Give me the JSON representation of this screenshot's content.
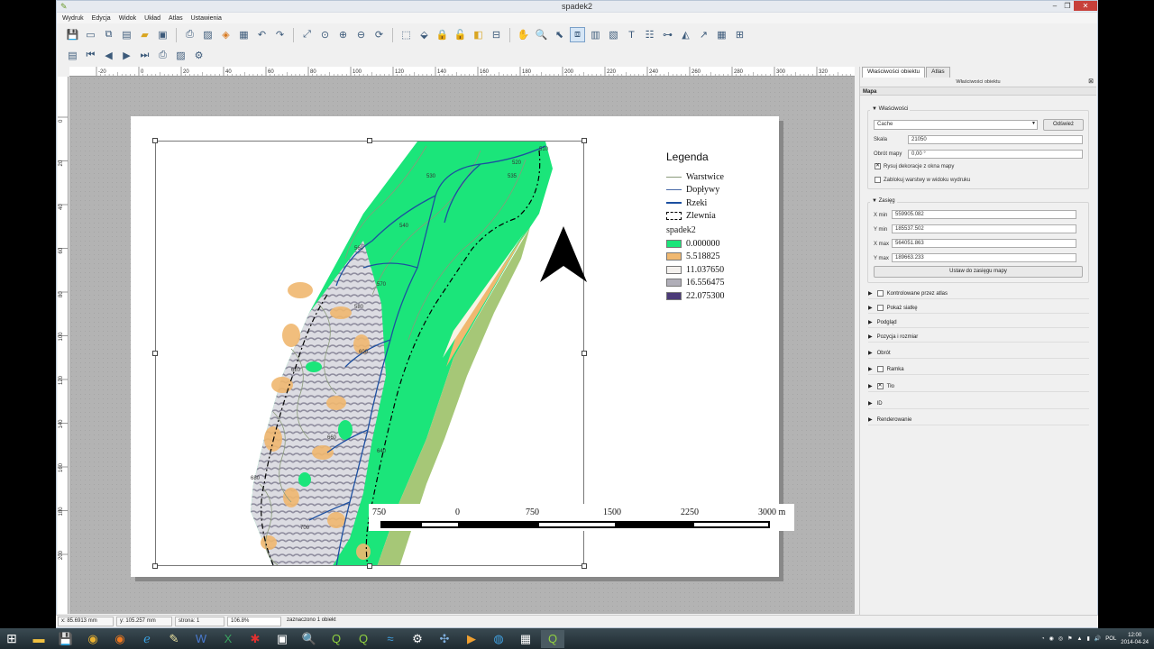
{
  "window": {
    "title": "spadek2"
  },
  "menu": [
    "Wydruk",
    "Edycja",
    "Widok",
    "Układ",
    "Atlas",
    "Ustawienia"
  ],
  "ruler": {
    "h_ticks": [
      "-20",
      "0",
      "20",
      "40",
      "60",
      "80",
      "100",
      "120",
      "140",
      "160",
      "180",
      "200",
      "220",
      "240",
      "260",
      "280",
      "300",
      "320"
    ],
    "v_ticks": [
      "0",
      "20",
      "40",
      "60",
      "80",
      "100",
      "120",
      "140",
      "160",
      "180",
      "200"
    ]
  },
  "legend": {
    "title": "Legenda",
    "items": [
      {
        "label": "Warstwice",
        "kind": "line",
        "color": "#8a9a7a"
      },
      {
        "label": "Dopływy",
        "kind": "line",
        "color": "#4a6aa8"
      },
      {
        "label": "Rzeki",
        "kind": "line",
        "color": "#1c4fa0"
      },
      {
        "label": "Zlewnia",
        "kind": "box",
        "color": "#000000"
      }
    ],
    "raster_name": "spadek2",
    "classes": [
      {
        "label": "0.000000",
        "color": "#1be57a"
      },
      {
        "label": "5.518825",
        "color": "#f0b870"
      },
      {
        "label": "11.037650",
        "color": "#f4f1ee"
      },
      {
        "label": "16.556475",
        "color": "#b0aeb8"
      },
      {
        "label": "22.075300",
        "color": "#4b3a78"
      }
    ]
  },
  "contours": [
    "510",
    "520",
    "530",
    "535",
    "540",
    "560",
    "570",
    "580",
    "600",
    "620",
    "640",
    "660",
    "680",
    "700"
  ],
  "scalebar": {
    "labels": [
      "750",
      "0",
      "750",
      "1500",
      "2250",
      "3000 m"
    ]
  },
  "dock": {
    "tabs": [
      "Właściwości obiektu",
      "Atlas"
    ],
    "header": "Właściwości obiektu",
    "section": "Mapa",
    "props_title": "Właściwości",
    "cache_value": "Cache",
    "refresh_button": "Odśwież",
    "scale_label": "Skala",
    "scale_value": "21050",
    "rotation_label": "Obrót mapy",
    "rotation_value": "0,00 °",
    "draw_decor": "Rysuj dekoracje z okna mapy",
    "lock_layers": "Zablokuj warstwy w widoku wydruku",
    "extent_title": "Zasięg",
    "xmin_label": "X min",
    "xmin": "559905.082",
    "ymin_label": "Y min",
    "ymin": "185537.502",
    "xmax_label": "X max",
    "xmax": "564051.863",
    "ymax_label": "Y max",
    "ymax": "189663.233",
    "set_extent": "Ustaw do zasięgu mapy",
    "collapsed": [
      "Kontrolowane przez atlas",
      "Pokaż siatkę",
      "Podgląd",
      "Pozycja i rozmiar",
      "Obrót",
      "Ramka",
      "Tło",
      "ID",
      "Renderowanie"
    ]
  },
  "status": {
    "x": "x: 85.6913 mm",
    "y": "y: 105.257 mm",
    "page": "strona: 1",
    "zoom": "106.8%",
    "selected": "zaznaczono 1 obiekt"
  },
  "tray": {
    "lang": "POL",
    "time": "12:00",
    "date": "2014-04-24"
  }
}
